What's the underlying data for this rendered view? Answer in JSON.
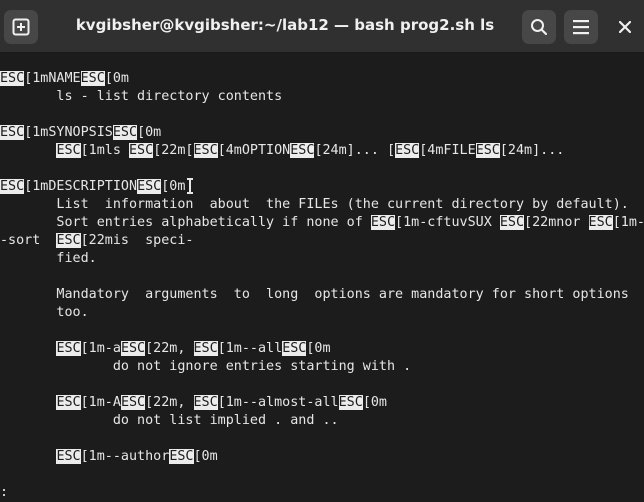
{
  "window": {
    "title": "kvgibsher@kvgibsher:~/lab12 — bash prog2.sh ls"
  },
  "icons": {
    "new_tab": "new-tab-icon",
    "search": "search-icon",
    "menu": "hamburger-menu-icon",
    "close": "close-icon"
  },
  "colors": {
    "terminal_bg": "#1c1c1c",
    "terminal_fg": "#e6e6e6",
    "titlebar_bg": "#303030",
    "esc_highlight_bg": "#ececec"
  },
  "terminal": {
    "lines": [
      [
        [
          "ESC",
          true
        ],
        [
          "[1mNAME",
          false
        ],
        [
          "ESC",
          true
        ],
        [
          "[0m",
          false
        ]
      ],
      [
        [
          "       ls - list directory contents",
          false
        ]
      ],
      [
        [
          "",
          false
        ]
      ],
      [
        [
          "ESC",
          true
        ],
        [
          "[1mSYNOPSIS",
          false
        ],
        [
          "ESC",
          true
        ],
        [
          "[0m",
          false
        ]
      ],
      [
        [
          "       ",
          false
        ],
        [
          "ESC",
          true
        ],
        [
          "[1mls ",
          false
        ],
        [
          "ESC",
          true
        ],
        [
          "[22m[",
          false
        ],
        [
          "ESC",
          true
        ],
        [
          "[4mOPTION",
          false
        ],
        [
          "ESC",
          true
        ],
        [
          "[24m]... [",
          false
        ],
        [
          "ESC",
          true
        ],
        [
          "[4mFILE",
          false
        ],
        [
          "ESC",
          true
        ],
        [
          "[24m]...",
          false
        ]
      ],
      [
        [
          "",
          false
        ]
      ],
      [
        [
          "ESC",
          true
        ],
        [
          "[1mDESCRIPTION",
          false
        ],
        [
          "ESC",
          true
        ],
        [
          "[0m",
          false
        ]
      ],
      [
        [
          "       List  information  about  the FILEs (the current directory by default).",
          false
        ]
      ],
      [
        [
          "       Sort entries alphabetically if none of ",
          false
        ],
        [
          "ESC",
          true
        ],
        [
          "[1m-cftuvSUX ",
          false
        ],
        [
          "ESC",
          true
        ],
        [
          "[22mnor ",
          false
        ],
        [
          "ESC",
          true
        ],
        [
          "[1m-",
          false
        ]
      ],
      [
        [
          "-sort  ",
          false
        ],
        [
          "ESC",
          true
        ],
        [
          "[22mis  speci-",
          false
        ]
      ],
      [
        [
          "       fied.",
          false
        ]
      ],
      [
        [
          "",
          false
        ]
      ],
      [
        [
          "       Mandatory  arguments  to  long  options are mandatory for short options",
          false
        ]
      ],
      [
        [
          "       too.",
          false
        ]
      ],
      [
        [
          "",
          false
        ]
      ],
      [
        [
          "       ",
          false
        ],
        [
          "ESC",
          true
        ],
        [
          "[1m-a",
          false
        ],
        [
          "ESC",
          true
        ],
        [
          "[22m, ",
          false
        ],
        [
          "ESC",
          true
        ],
        [
          "[1m--all",
          false
        ],
        [
          "ESC",
          true
        ],
        [
          "[0m",
          false
        ]
      ],
      [
        [
          "              do not ignore entries starting with .",
          false
        ]
      ],
      [
        [
          "",
          false
        ]
      ],
      [
        [
          "       ",
          false
        ],
        [
          "ESC",
          true
        ],
        [
          "[1m-A",
          false
        ],
        [
          "ESC",
          true
        ],
        [
          "[22m, ",
          false
        ],
        [
          "ESC",
          true
        ],
        [
          "[1m--almost-all",
          false
        ],
        [
          "ESC",
          true
        ],
        [
          "[0m",
          false
        ]
      ],
      [
        [
          "              do not list implied . and ..",
          false
        ]
      ],
      [
        [
          "",
          false
        ]
      ],
      [
        [
          "       ",
          false
        ],
        [
          "ESC",
          true
        ],
        [
          "[1m--author",
          false
        ],
        [
          "ESC",
          true
        ],
        [
          "[0m",
          false
        ]
      ],
      [
        [
          "",
          false
        ]
      ],
      [
        [
          ":",
          false
        ]
      ]
    ]
  }
}
